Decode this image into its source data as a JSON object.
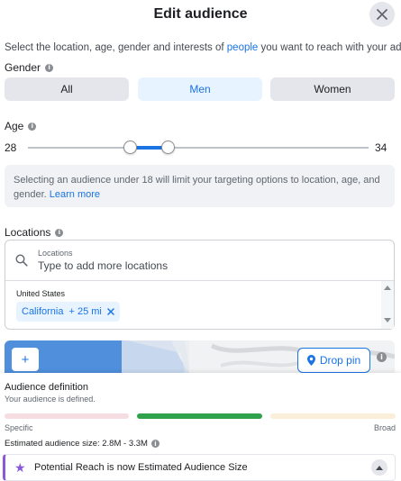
{
  "header": {
    "title": "Edit audience"
  },
  "intro": {
    "before": "Select the location, age, gender and interests of ",
    "link": "people",
    "after": " you want to reach with your ad."
  },
  "gender": {
    "label": "Gender",
    "options": [
      "All",
      "Men",
      "Women"
    ],
    "selected": "Men"
  },
  "age": {
    "label": "Age",
    "min_label": "28",
    "max_label": "34",
    "selected_low": 28,
    "selected_high": 34
  },
  "notice": {
    "text": "Selecting an audience under 18 will limit your targeting options to location, age, and gender. ",
    "link": "Learn more"
  },
  "locations": {
    "label": "Locations",
    "search_label": "Locations",
    "placeholder": "Type to add more locations",
    "country": "United States",
    "selected": {
      "name": "California",
      "radius": "+ 25 mi"
    }
  },
  "map": {
    "zoom_in": "+",
    "drop_pin": "Drop pin"
  },
  "definition": {
    "title": "Audience definition",
    "subtitle": "Your audience is defined.",
    "scale_left": "Specific",
    "scale_right": "Broad",
    "estimate": "Estimated audience size: 2.8M - 3.3M",
    "level": "middle"
  },
  "banner": {
    "text": "Potential Reach is now Estimated Audience Size"
  },
  "colors": {
    "accent": "#1b74e4",
    "meter_specific": "#f5dde2",
    "meter_middle": "#31a24c",
    "meter_broad": "#fcefd9",
    "banner_accent": "#8a58d8"
  }
}
